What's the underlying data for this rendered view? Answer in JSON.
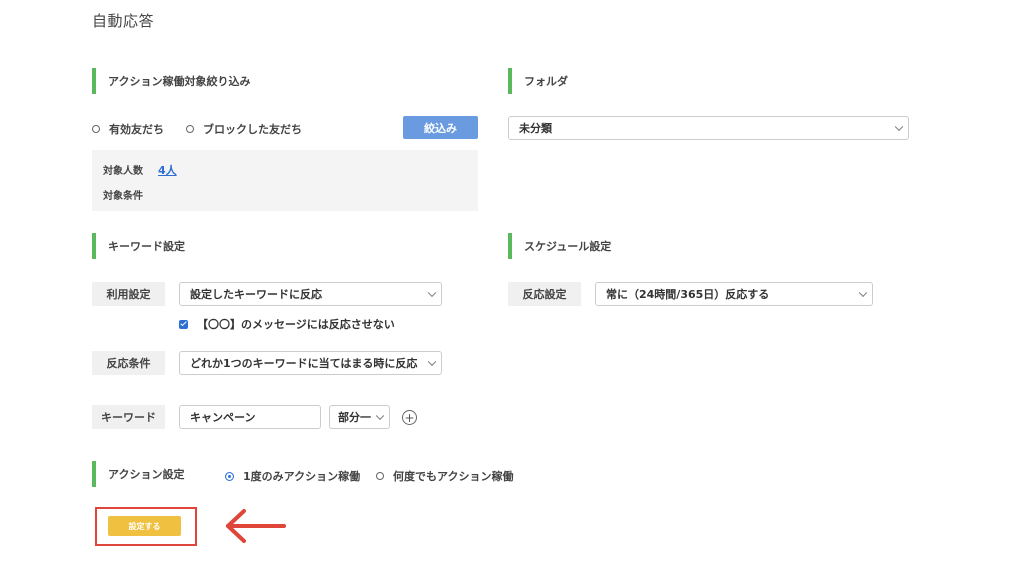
{
  "page": {
    "title": "自動応答"
  },
  "filter": {
    "heading": "アクション稼働対象絞り込み",
    "radio_active_friends": "有効友だち",
    "radio_blocked_friends": "ブロックした友だち",
    "filter_button": "絞込み",
    "target_count_label": "対象人数",
    "target_count_value": "4人",
    "target_condition_label": "対象条件"
  },
  "folder": {
    "heading": "フォルダ",
    "selected": "未分類"
  },
  "keyword_settings": {
    "heading": "キーワード設定",
    "usage_label": "利用設定",
    "usage_selected": "設定したキーワードに反応",
    "ignore_checkbox_label": "【〇〇】のメッセージには反応させない",
    "ignore_checked": true,
    "condition_label": "反応条件",
    "condition_selected": "どれか1つのキーワードに当てはまる時に反応",
    "keyword_label": "キーワード",
    "keyword_value": "キャンペーン",
    "match_selected": "部分一"
  },
  "schedule": {
    "heading": "スケジュール設定",
    "response_label": "反応設定",
    "response_selected": "常に（24時間/365日）反応する"
  },
  "action": {
    "heading": "アクション設定",
    "option_once": "1度のみアクション稼働",
    "option_always": "何度でもアクション稼働",
    "selected": "once"
  },
  "submit": {
    "label": "設定する"
  },
  "colors": {
    "accent_green": "#5cb85c",
    "button_blue": "#6a9be0",
    "button_yellow": "#f0c040",
    "annotation_red": "#e0453a"
  }
}
